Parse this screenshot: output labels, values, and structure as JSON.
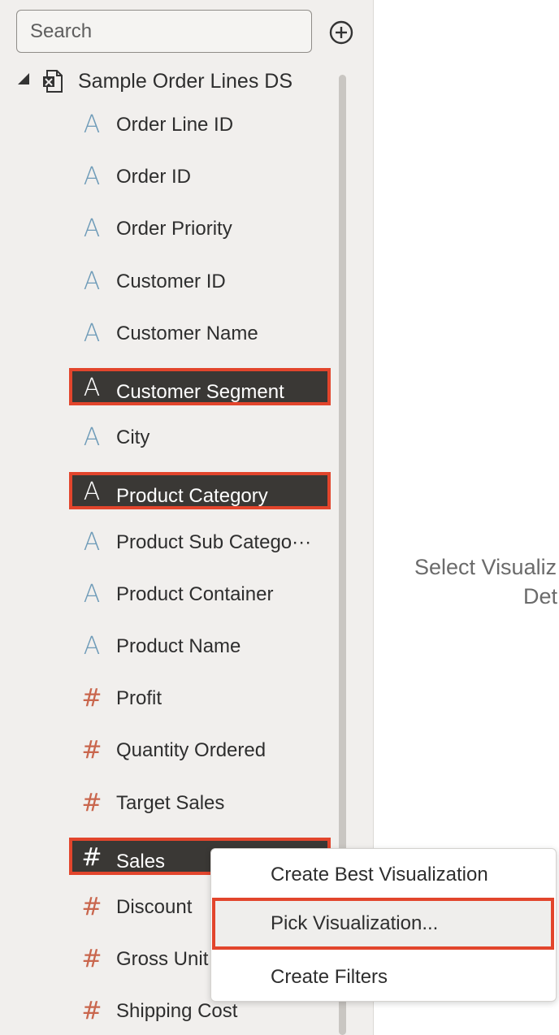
{
  "search": {
    "placeholder": "Search"
  },
  "datasource": {
    "label": "Sample Order Lines DS"
  },
  "fields": [
    {
      "label": "Order Line ID",
      "kind": "attribute",
      "glyph": "A",
      "selected": false
    },
    {
      "label": "Order ID",
      "kind": "attribute",
      "glyph": "A",
      "selected": false
    },
    {
      "label": "Order Priority",
      "kind": "attribute",
      "glyph": "A",
      "selected": false
    },
    {
      "label": "Customer ID",
      "kind": "attribute",
      "glyph": "A",
      "selected": false
    },
    {
      "label": "Customer Name",
      "kind": "attribute",
      "glyph": "A",
      "selected": false
    },
    {
      "label": "Customer Segment",
      "kind": "attribute",
      "glyph": "A",
      "selected": true
    },
    {
      "label": "City",
      "kind": "attribute",
      "glyph": "A",
      "selected": false
    },
    {
      "label": "Product Category",
      "kind": "attribute",
      "glyph": "A",
      "selected": true
    },
    {
      "label": "Product Sub Catego···",
      "kind": "attribute",
      "glyph": "A",
      "selected": false
    },
    {
      "label": "Product Container",
      "kind": "attribute",
      "glyph": "A",
      "selected": false
    },
    {
      "label": "Product Name",
      "kind": "attribute",
      "glyph": "A",
      "selected": false
    },
    {
      "label": "Profit",
      "kind": "measure",
      "glyph": "#",
      "selected": false
    },
    {
      "label": "Quantity Ordered",
      "kind": "measure",
      "glyph": "#",
      "selected": false
    },
    {
      "label": "Target Sales",
      "kind": "measure",
      "glyph": "#",
      "selected": false
    },
    {
      "label": "Sales",
      "kind": "measure",
      "glyph": "#",
      "selected": true
    },
    {
      "label": "Discount",
      "kind": "measure",
      "glyph": "#",
      "selected": false
    },
    {
      "label": "Gross Unit",
      "kind": "measure",
      "glyph": "#",
      "selected": false
    },
    {
      "label": "Shipping Cost",
      "kind": "measure",
      "glyph": "#",
      "selected": false
    }
  ],
  "canvas": {
    "line1": "Select Visualiz",
    "line2": "Det"
  },
  "context_menu": {
    "items": [
      {
        "label": "Create Best Visualization"
      },
      {
        "label": "Pick Visualization..."
      },
      {
        "label": "Create Filters"
      }
    ]
  },
  "colors": {
    "attribute_icon": "#6e9bb8",
    "measure_icon": "#c9664d",
    "highlight": "#e2452c",
    "selected_bg": "#3a3835"
  }
}
